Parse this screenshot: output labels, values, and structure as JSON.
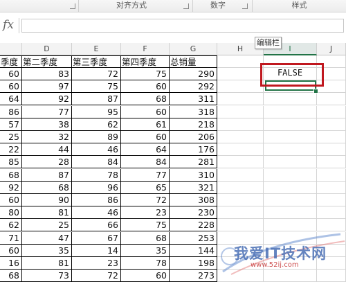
{
  "ribbon": {
    "groups": [
      {
        "label": ""
      },
      {
        "label": "对齐方式"
      },
      {
        "label": "数字"
      },
      {
        "label": "样式"
      }
    ]
  },
  "formula_bar": {
    "fx_label": "fx",
    "value": "",
    "tooltip": "编辑栏"
  },
  "columns": [
    {
      "letter": ""
    },
    {
      "letter": "D"
    },
    {
      "letter": "E"
    },
    {
      "letter": "F"
    },
    {
      "letter": "G"
    },
    {
      "letter": "H"
    },
    {
      "letter": "I"
    },
    {
      "letter": "J"
    }
  ],
  "headers": [
    "季度",
    "第二季度",
    "第三季度",
    "第四季度",
    "总销量"
  ],
  "rows": [
    [
      "60",
      "83",
      "72",
      "75",
      "290"
    ],
    [
      "60",
      "97",
      "75",
      "60",
      "292"
    ],
    [
      "64",
      "92",
      "87",
      "68",
      "311"
    ],
    [
      "86",
      "77",
      "95",
      "60",
      "318"
    ],
    [
      "57",
      "38",
      "62",
      "61",
      "218"
    ],
    [
      "25",
      "32",
      "89",
      "60",
      "206"
    ],
    [
      "22",
      "44",
      "46",
      "64",
      "176"
    ],
    [
      "85",
      "28",
      "84",
      "84",
      "281"
    ],
    [
      "68",
      "87",
      "78",
      "77",
      "310"
    ],
    [
      "92",
      "68",
      "96",
      "65",
      "321"
    ],
    [
      "60",
      "90",
      "86",
      "72",
      "308"
    ],
    [
      "80",
      "81",
      "46",
      "23",
      "230"
    ],
    [
      "62",
      "25",
      "66",
      "75",
      "228"
    ],
    [
      "71",
      "47",
      "67",
      "68",
      "253"
    ],
    [
      "60",
      "35",
      "14",
      "35",
      "144"
    ],
    [
      "16",
      "81",
      "23",
      "78",
      "198"
    ],
    [
      "68",
      "73",
      "72",
      "60",
      "273"
    ]
  ],
  "result_cell": {
    "value": "FALSE"
  },
  "watermark": {
    "text": "我爱IT技术网",
    "url": "www.52ij.com"
  },
  "colors": {
    "accent": "#217346",
    "highlight_box": "#c0181f"
  }
}
